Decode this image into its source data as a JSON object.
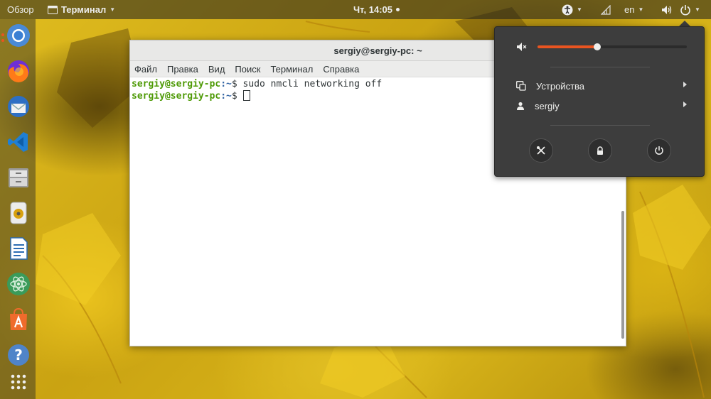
{
  "topbar": {
    "overview_label": "Обзор",
    "app_label": "Терминал",
    "clock": "Чт, 14:05",
    "language": "en"
  },
  "dock": {
    "items": [
      {
        "name": "chromium-icon",
        "running": true
      },
      {
        "name": "firefox-icon",
        "running": false
      },
      {
        "name": "thunderbird-icon",
        "running": false
      },
      {
        "name": "vscode-icon",
        "running": false
      },
      {
        "name": "files-icon",
        "running": true
      },
      {
        "name": "rhythmbox-icon",
        "running": false
      },
      {
        "name": "libreoffice-writer-icon",
        "running": false
      },
      {
        "name": "atom-icon",
        "running": false
      },
      {
        "name": "software-center-icon",
        "running": false
      },
      {
        "name": "help-icon",
        "running": false
      },
      {
        "name": "show-apps-icon",
        "running": false
      }
    ]
  },
  "terminal": {
    "title": "sergiy@sergiy-pc: ~",
    "menu": [
      "Файл",
      "Правка",
      "Вид",
      "Поиск",
      "Терминал",
      "Справка"
    ],
    "prompt_user": "sergiy@sergiy-pc",
    "prompt_path": ":~",
    "prompt_symbol": "$ ",
    "lines": [
      {
        "command": "sudo nmcli networking off"
      },
      {
        "command": ""
      }
    ]
  },
  "system_menu": {
    "volume_percent": 40,
    "devices_label": "Устройства",
    "user_label": "sergiy",
    "buttons": [
      "settings-icon",
      "lock-icon",
      "power-icon"
    ]
  },
  "colors": {
    "accent": "#e95420",
    "prompt_user": "#4e9a06",
    "prompt_path": "#3465a4",
    "popover_bg": "#3d3d3d"
  }
}
